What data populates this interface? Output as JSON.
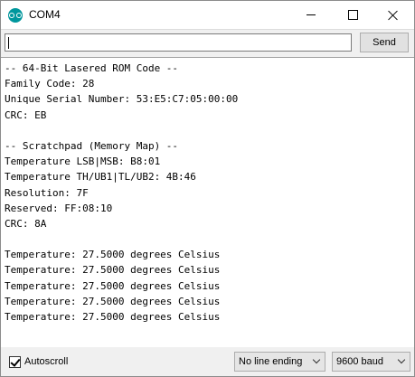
{
  "window": {
    "title": "COM4"
  },
  "toolbar": {
    "input_value": "",
    "send_label": "Send"
  },
  "output": {
    "lines": [
      "-- 64-Bit Lasered ROM Code --",
      "Family Code: 28",
      "Unique Serial Number: 53:E5:C7:05:00:00",
      "CRC: EB",
      "",
      "-- Scratchpad (Memory Map) --",
      "Temperature LSB|MSB: B8:01",
      "Temperature TH/UB1|TL/UB2: 4B:46",
      "Resolution: 7F",
      "Reserved: FF:08:10",
      "CRC: 8A",
      "",
      "Temperature: 27.5000 degrees Celsius",
      "Temperature: 27.5000 degrees Celsius",
      "Temperature: 27.5000 degrees Celsius",
      "Temperature: 27.5000 degrees Celsius",
      "Temperature: 27.5000 degrees Celsius"
    ]
  },
  "bottombar": {
    "autoscroll_label": "Autoscroll",
    "autoscroll_checked": true,
    "line_ending": "No line ending",
    "baud_rate": "9600 baud"
  },
  "colors": {
    "app_icon": "#00979d",
    "chrome_bg": "#f0f0f0"
  },
  "icons": [
    "arduino-app-icon",
    "minimize-icon",
    "maximize-icon",
    "close-icon",
    "checkmark-icon",
    "chevron-down-icon"
  ]
}
